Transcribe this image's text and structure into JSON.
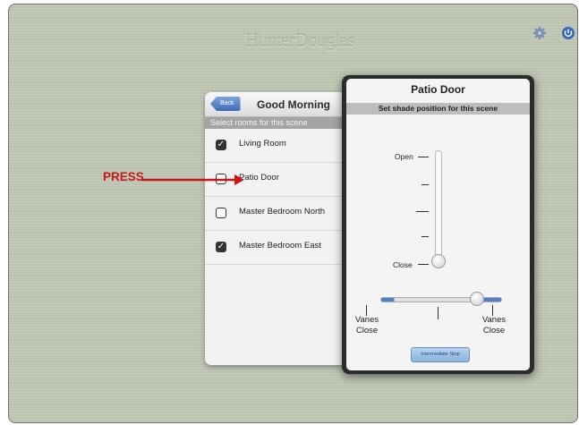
{
  "app": {
    "brand": "HunterDouglas",
    "icons": {
      "settings": "gear-icon",
      "power": "power-icon"
    }
  },
  "scene_panel": {
    "back_label": "Back",
    "title": "Good Morning",
    "subtitle": "Select rooms for this scene",
    "rooms": [
      {
        "label": "Living Room",
        "checked": true
      },
      {
        "label": "Patio Door",
        "checked": false
      },
      {
        "label": "Master Bedroom North",
        "checked": false
      },
      {
        "label": "Master Bedroom East",
        "checked": true
      }
    ]
  },
  "annotation": {
    "press": "PRESS",
    "color": "#c8161d"
  },
  "patio_door": {
    "title": "Patio Door",
    "subtitle": "Set shade position for this scene",
    "open_label": "Open",
    "close_label": "Close",
    "shade_position": 0,
    "vanes_left": [
      "Vanes",
      "Close"
    ],
    "vanes_right": [
      "Vanes",
      "Close"
    ],
    "intermediate_stop_label": "Intermediate Stop",
    "accent": "#4f7fce"
  }
}
